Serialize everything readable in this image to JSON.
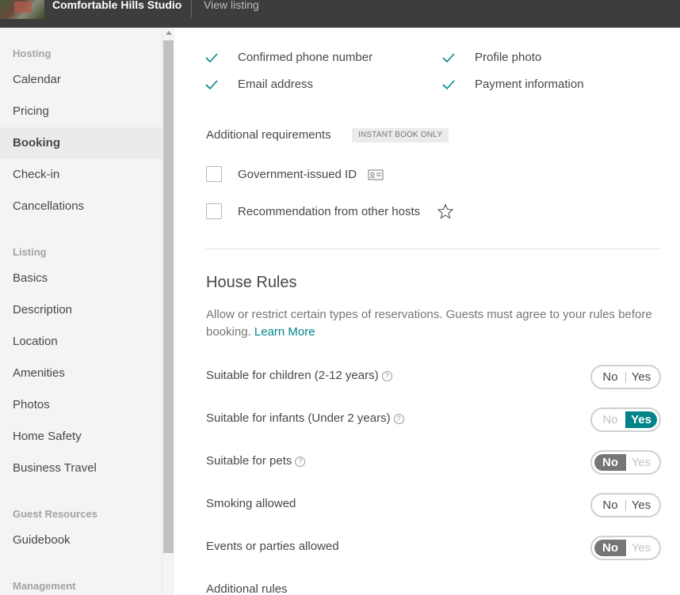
{
  "topbar": {
    "listing_name": "Comfortable Hills Studio",
    "view_listing": "View listing"
  },
  "sidebar": {
    "sections": [
      {
        "heading": "Hosting",
        "items": [
          "Calendar",
          "Pricing",
          "Booking",
          "Check-in",
          "Cancellations"
        ]
      },
      {
        "heading": "Listing",
        "items": [
          "Basics",
          "Description",
          "Location",
          "Amenities",
          "Photos",
          "Home Safety",
          "Business Travel"
        ]
      },
      {
        "heading": "Guest Resources",
        "items": [
          "Guidebook"
        ]
      },
      {
        "heading": "Management",
        "items": []
      }
    ],
    "active_item": "Booking"
  },
  "requirements": {
    "checked": [
      "Confirmed phone number",
      "Email address",
      "Profile photo",
      "Payment information"
    ],
    "additional_label": "Additional requirements",
    "badge": "INSTANT BOOK ONLY",
    "options": [
      {
        "label": "Government-issued ID",
        "icon": "id-card-icon",
        "checked": false
      },
      {
        "label": "Recommendation from other hosts",
        "icon": "star-icon",
        "checked": false
      }
    ]
  },
  "house_rules": {
    "title": "House Rules",
    "description": "Allow or restrict certain types of reservations. Guests must agree to your rules before booking.",
    "learn_more": "Learn More",
    "rules": [
      {
        "label": "Suitable for children (2-12 years)",
        "help": true,
        "value": "none"
      },
      {
        "label": "Suitable for infants (Under 2 years)",
        "help": true,
        "value": "yes"
      },
      {
        "label": "Suitable for pets",
        "help": true,
        "value": "no"
      },
      {
        "label": "Smoking allowed",
        "help": false,
        "value": "none"
      },
      {
        "label": "Events or parties allowed",
        "help": false,
        "value": "no"
      }
    ],
    "no_label": "No",
    "yes_label": "Yes",
    "additional_rules": "Additional rules"
  },
  "colors": {
    "accent": "#008489",
    "selected_no": "#767676",
    "topbar": "#3d3d3d"
  }
}
